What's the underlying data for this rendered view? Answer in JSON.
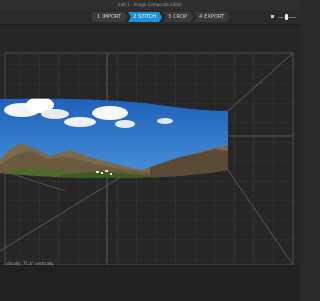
{
  "window": {
    "title": "Irati 1 - Image Composite Editor"
  },
  "steps": [
    {
      "number": "1",
      "label": "IMPORT",
      "active": false
    },
    {
      "number": "2",
      "label": "STITCH",
      "active": true
    },
    {
      "number": "3",
      "label": "CROP",
      "active": false
    },
    {
      "number": "4",
      "label": "EXPORT",
      "active": false
    }
  ],
  "status": {
    "text": "...rtically, 71.4° vertically."
  },
  "colors": {
    "accent": "#1f8fd6",
    "background": "#262626"
  }
}
